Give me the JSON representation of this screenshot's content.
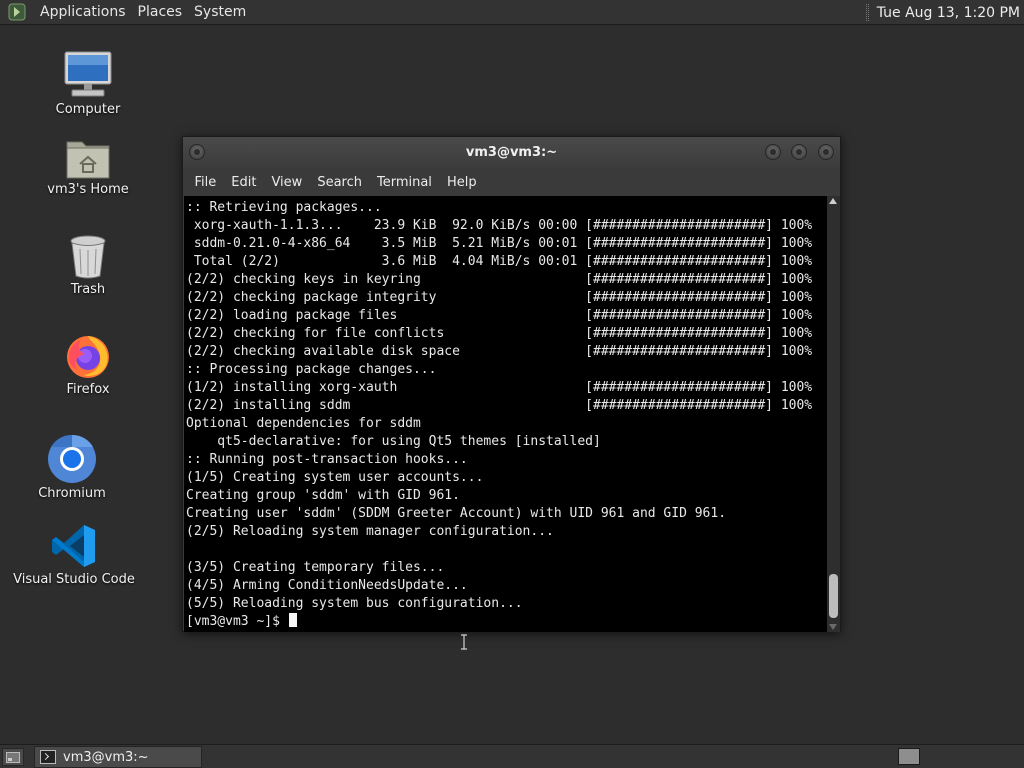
{
  "top_panel": {
    "menus": [
      "Applications",
      "Places",
      "System"
    ],
    "clock": "Tue Aug 13,  1:20 PM"
  },
  "desktop_icons": [
    {
      "label": "Computer",
      "icon": "computer-icon"
    },
    {
      "label": "vm3's Home",
      "icon": "home-folder-icon"
    },
    {
      "label": "Trash",
      "icon": "trash-icon"
    },
    {
      "label": "Firefox",
      "icon": "firefox-icon"
    },
    {
      "label": "Chromium",
      "icon": "chromium-icon"
    },
    {
      "label": "Visual Studio Code",
      "icon": "vscode-icon"
    }
  ],
  "terminal": {
    "title": "vm3@vm3:~",
    "menu": [
      "File",
      "Edit",
      "View",
      "Search",
      "Terminal",
      "Help"
    ],
    "lines": [
      ":: Retrieving packages...",
      " xorg-xauth-1.1.3...    23.9 KiB  92.0 KiB/s 00:00 [######################] 100%",
      " sddm-0.21.0-4-x86_64    3.5 MiB  5.21 MiB/s 00:01 [######################] 100%",
      " Total (2/2)             3.6 MiB  4.04 MiB/s 00:01 [######################] 100%",
      "(2/2) checking keys in keyring                     [######################] 100%",
      "(2/2) checking package integrity                   [######################] 100%",
      "(2/2) loading package files                        [######################] 100%",
      "(2/2) checking for file conflicts                  [######################] 100%",
      "(2/2) checking available disk space                [######################] 100%",
      ":: Processing package changes...",
      "(1/2) installing xorg-xauth                        [######################] 100%",
      "(2/2) installing sddm                              [######################] 100%",
      "Optional dependencies for sddm",
      "    qt5-declarative: for using Qt5 themes [installed]",
      ":: Running post-transaction hooks...",
      "(1/5) Creating system user accounts...",
      "Creating group 'sddm' with GID 961.",
      "Creating user 'sddm' (SDDM Greeter Account) with UID 961 and GID 961.",
      "(2/5) Reloading system manager configuration...",
      "",
      "(3/5) Creating temporary files...",
      "(4/5) Arming ConditionNeedsUpdate...",
      "(5/5) Reloading system bus configuration..."
    ],
    "prompt": "[vm3@vm3 ~]$ "
  },
  "taskbar": {
    "window_label": "vm3@vm3:~"
  },
  "colors": {
    "desktop_bg": "#2d2d2d",
    "panel_bg": "#333333",
    "terminal_bg": "#000000",
    "terminal_fg": "#e9e9e9"
  }
}
